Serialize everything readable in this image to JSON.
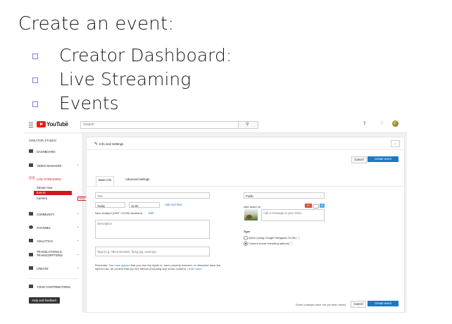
{
  "slide": {
    "title": "Create an event:",
    "bullets": [
      "Creator Dashboard:",
      "Live Streaming",
      "Events"
    ]
  },
  "youtube": {
    "logo_text": "YouTube",
    "region": "NZ",
    "search_placeholder": "Search",
    "sidebar": {
      "header": "CREATOR STUDIO",
      "items": [
        {
          "label": "DASHBOARD",
          "icon": "dashboard-icon"
        },
        {
          "label": "VIDEO MANAGER",
          "icon": "video-manager-icon"
        },
        {
          "label": "LIVE STREAMING",
          "icon": "live-icon"
        },
        {
          "label": "COMMUNITY",
          "icon": "community-icon"
        },
        {
          "label": "CHANNEL",
          "icon": "channel-icon"
        },
        {
          "label": "ANALYTICS",
          "icon": "analytics-icon"
        },
        {
          "label": "TRANSLATIONS & TRANSCRIPTIONS",
          "icon": "translate-icon"
        },
        {
          "label": "CREATE",
          "icon": "create-icon"
        },
        {
          "label": "YOUR CONTRIBUTIONS",
          "icon": "contributions-icon"
        }
      ],
      "live_subitems": [
        "Stream now",
        "Events",
        "Camera"
      ],
      "new_badge": "NEW",
      "help_button": "Help and feedback"
    },
    "panel": {
      "title": "Info and Settings",
      "cancel_label": "Cancel",
      "create_label": "Create event",
      "tabs": [
        "Basic info",
        "Advanced settings"
      ],
      "title_placeholder": "Title",
      "date_value": "Today",
      "time_value": "12:00",
      "add_end_time": "Add end time",
      "timezone": "New Zealand (GMT +13:00) Auckland",
      "edit_link": "Edit",
      "description_placeholder": "Description",
      "tags_placeholder": "Tags (e.g. Albert Einstein, flying pig, mashup)",
      "privacy_value": "Public",
      "also_share_on": "Also share on",
      "gplus_label": "G+",
      "twitter_label": "t",
      "share_message_placeholder": "Add a message to your video",
      "type_label": "Type",
      "type_quick": "Quick (using Google Hangouts On Air)",
      "type_custom": "Custom (more encoding options)",
      "reminder_prefix": "Reminder: You ",
      "reminder_link1": "have agreed",
      "reminder_mid": " that you own the rights to, have properly licensed, or otherwise have the right to use, all content that you live stream (including any music content). ",
      "reminder_link2": "Learn more",
      "unsaved_note": "Some changes have not yet been saved.",
      "cancel2_label": "Cancel",
      "create2_label": "Create event"
    }
  }
}
